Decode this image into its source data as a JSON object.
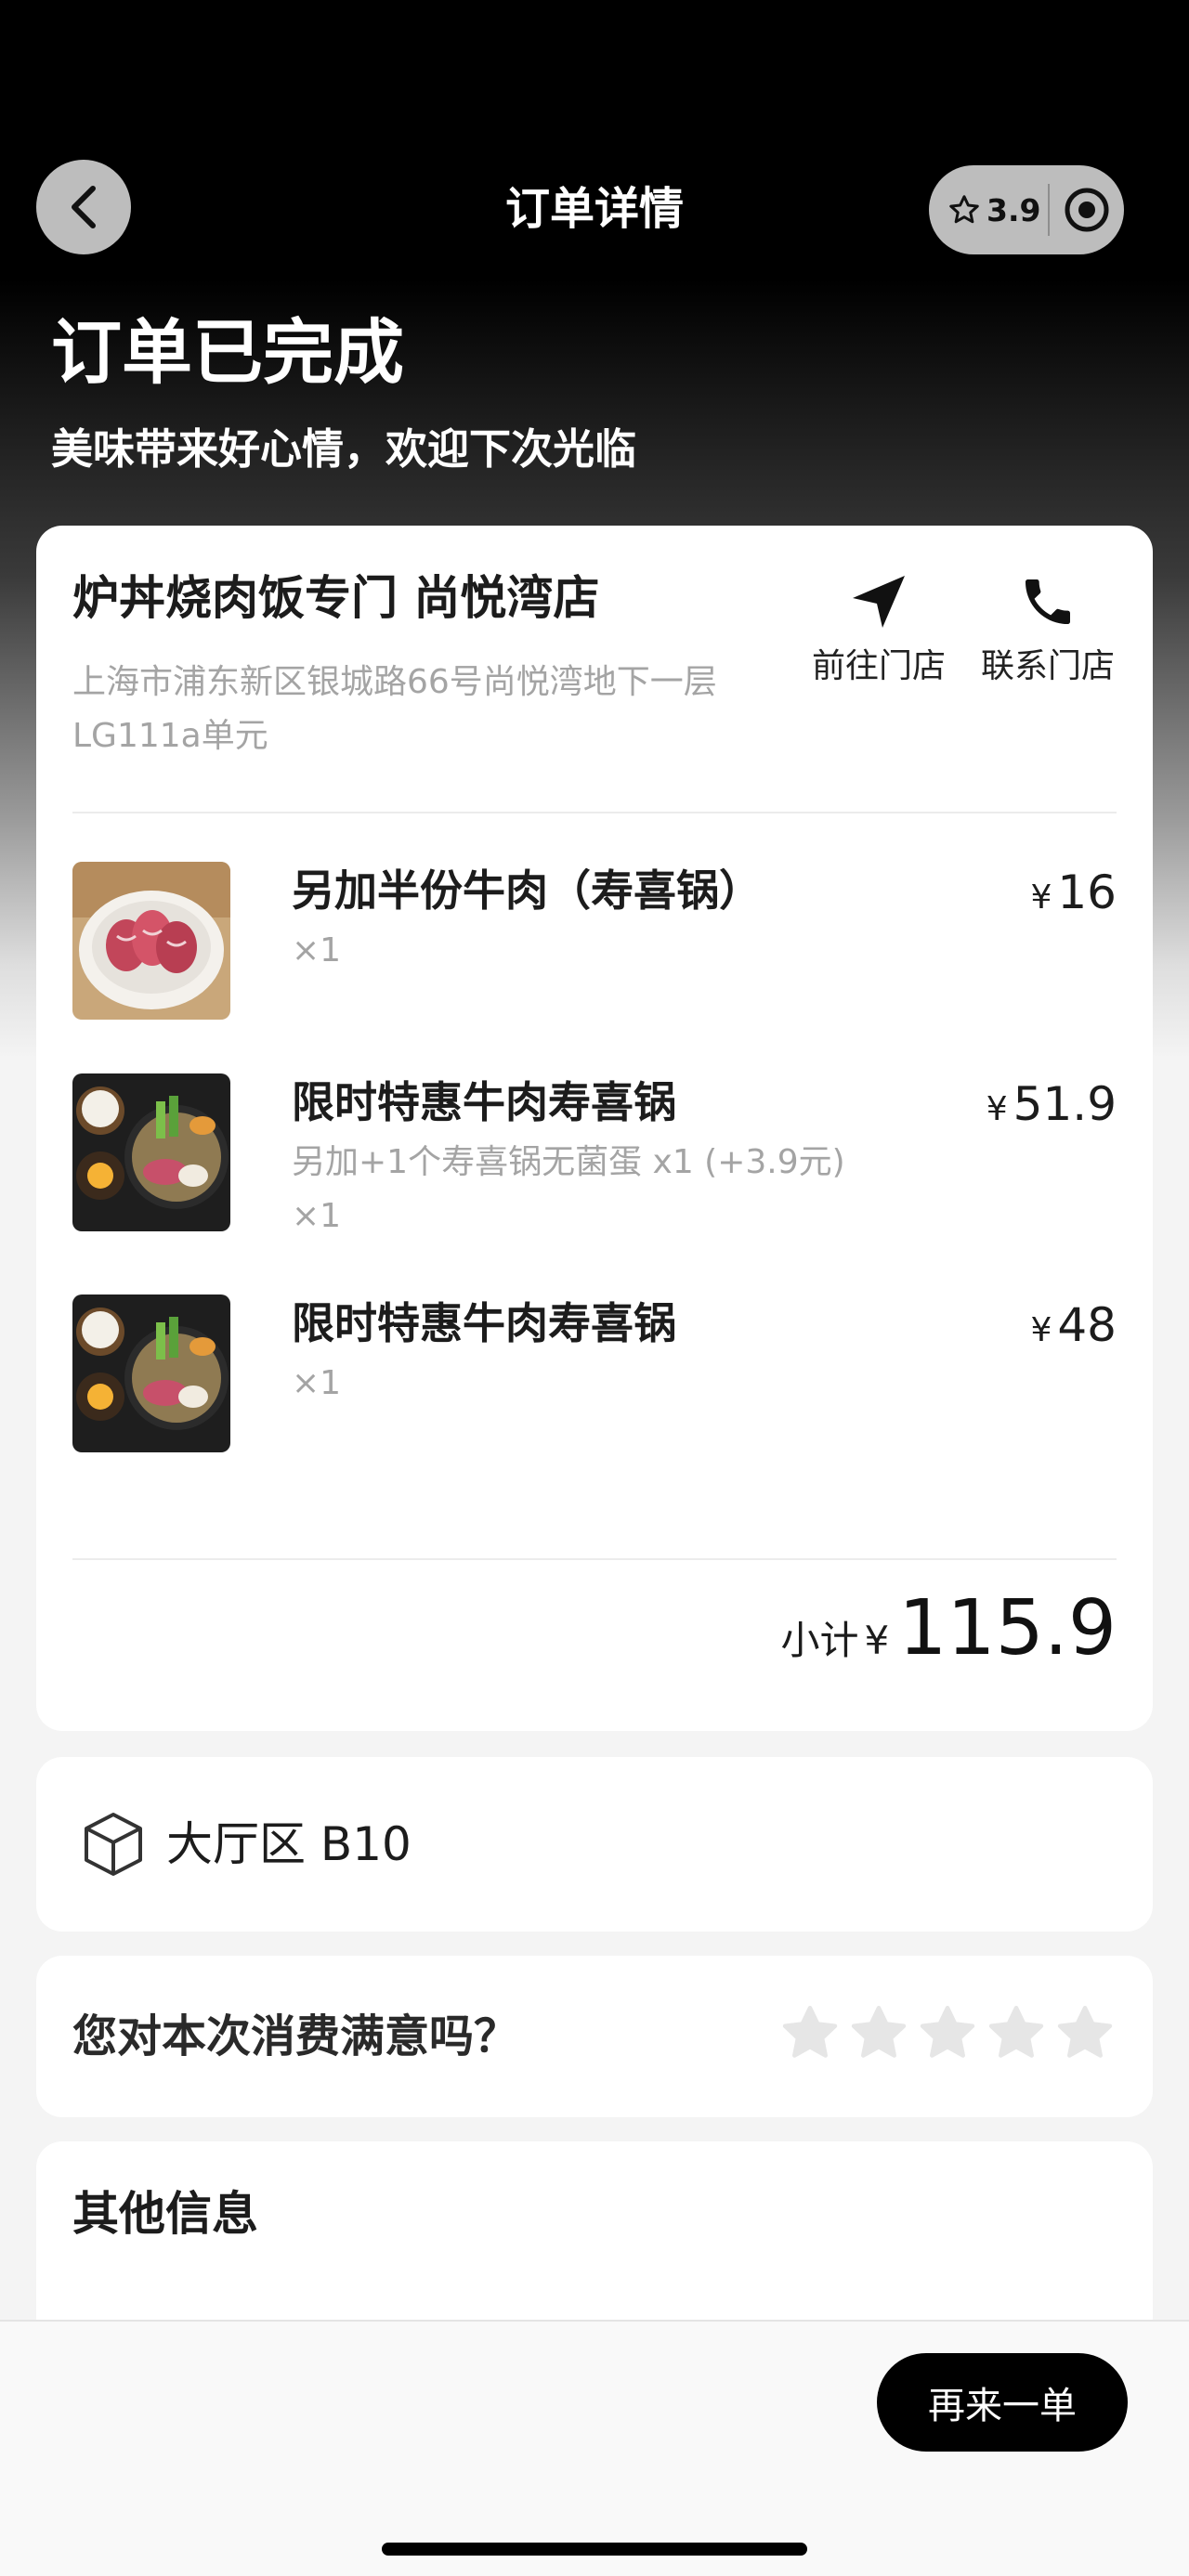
{
  "nav": {
    "title": "订单详情",
    "rating": "3.9",
    "back_icon": "chevron-left-icon",
    "capsule_icon": "target-icon"
  },
  "status": {
    "title": "订单已完成",
    "subtitle": "美味带来好心情，欢迎下次光临"
  },
  "store": {
    "name": "炉丼烧肉饭专门 尚悦湾店",
    "address": "上海市浦东新区银城路66号尚悦湾地下一层LG111a单元",
    "navigate_label": "前往门店",
    "call_label": "联系门店"
  },
  "items": [
    {
      "name": "另加半份牛肉（寿喜锅）",
      "spec": "",
      "qty": "×1",
      "currency": "¥",
      "price": "16",
      "image": "raw-beef-bowl"
    },
    {
      "name": "限时特惠牛肉寿喜锅",
      "spec": "另加+1个寿喜锅无菌蛋 x1 (+3.9元)",
      "qty": "×1",
      "currency": "¥",
      "price": "51.9",
      "image": "sukiyaki-set"
    },
    {
      "name": "限时特惠牛肉寿喜锅",
      "spec": "",
      "qty": "×1",
      "currency": "¥",
      "price": "48",
      "image": "sukiyaki-set"
    }
  ],
  "subtotal": {
    "label": "小计",
    "currency": "¥",
    "value": "115.9"
  },
  "table": {
    "text": "大厅区 B10",
    "icon": "cube-icon"
  },
  "rating_prompt": {
    "question": "您对本次消费满意吗？",
    "stars_total": 5,
    "stars_selected": 0
  },
  "other_info": {
    "title": "其他信息"
  },
  "bottom": {
    "reorder_label": "再来一单"
  },
  "colors": {
    "accent": "#000000",
    "muted_text": "#a4a4a4",
    "card_bg": "#ffffff",
    "page_bg": "#f4f4f4"
  }
}
